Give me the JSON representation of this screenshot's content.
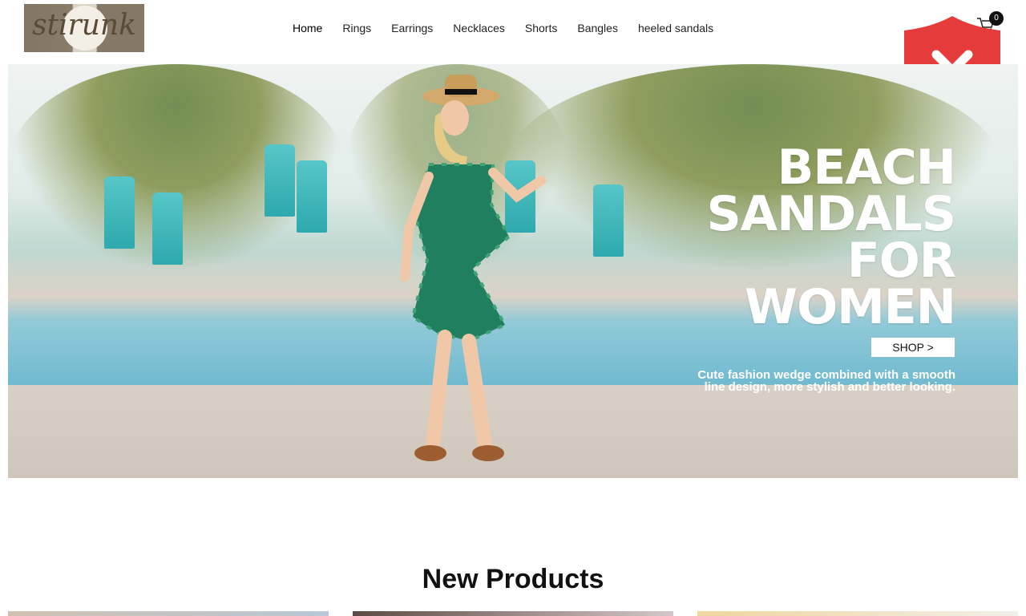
{
  "brand": {
    "logo_text": "stirunk"
  },
  "nav": {
    "items": [
      "Home",
      "Rings",
      "Earrings",
      "Necklaces",
      "Shorts",
      "Bangles",
      "heeled sandals"
    ],
    "active": "Home"
  },
  "cart": {
    "count": "0",
    "icon": "cart-icon"
  },
  "overlay": {
    "icon": "shield-close-icon",
    "color": "#e63b3b"
  },
  "hero": {
    "title_lines": [
      "BEACH",
      "SANDALS",
      "FOR",
      "WOMEN"
    ],
    "button_label": "SHOP >",
    "subtitle_line1": "Cute fashion wedge combined with a smooth",
    "subtitle_line2": "line design, more stylish and better looking."
  },
  "section": {
    "title": "New Products"
  },
  "colors": {
    "text": "#222222",
    "badge": "#111111",
    "shield": "#e63b3b",
    "pool": "#6fb9cf"
  }
}
